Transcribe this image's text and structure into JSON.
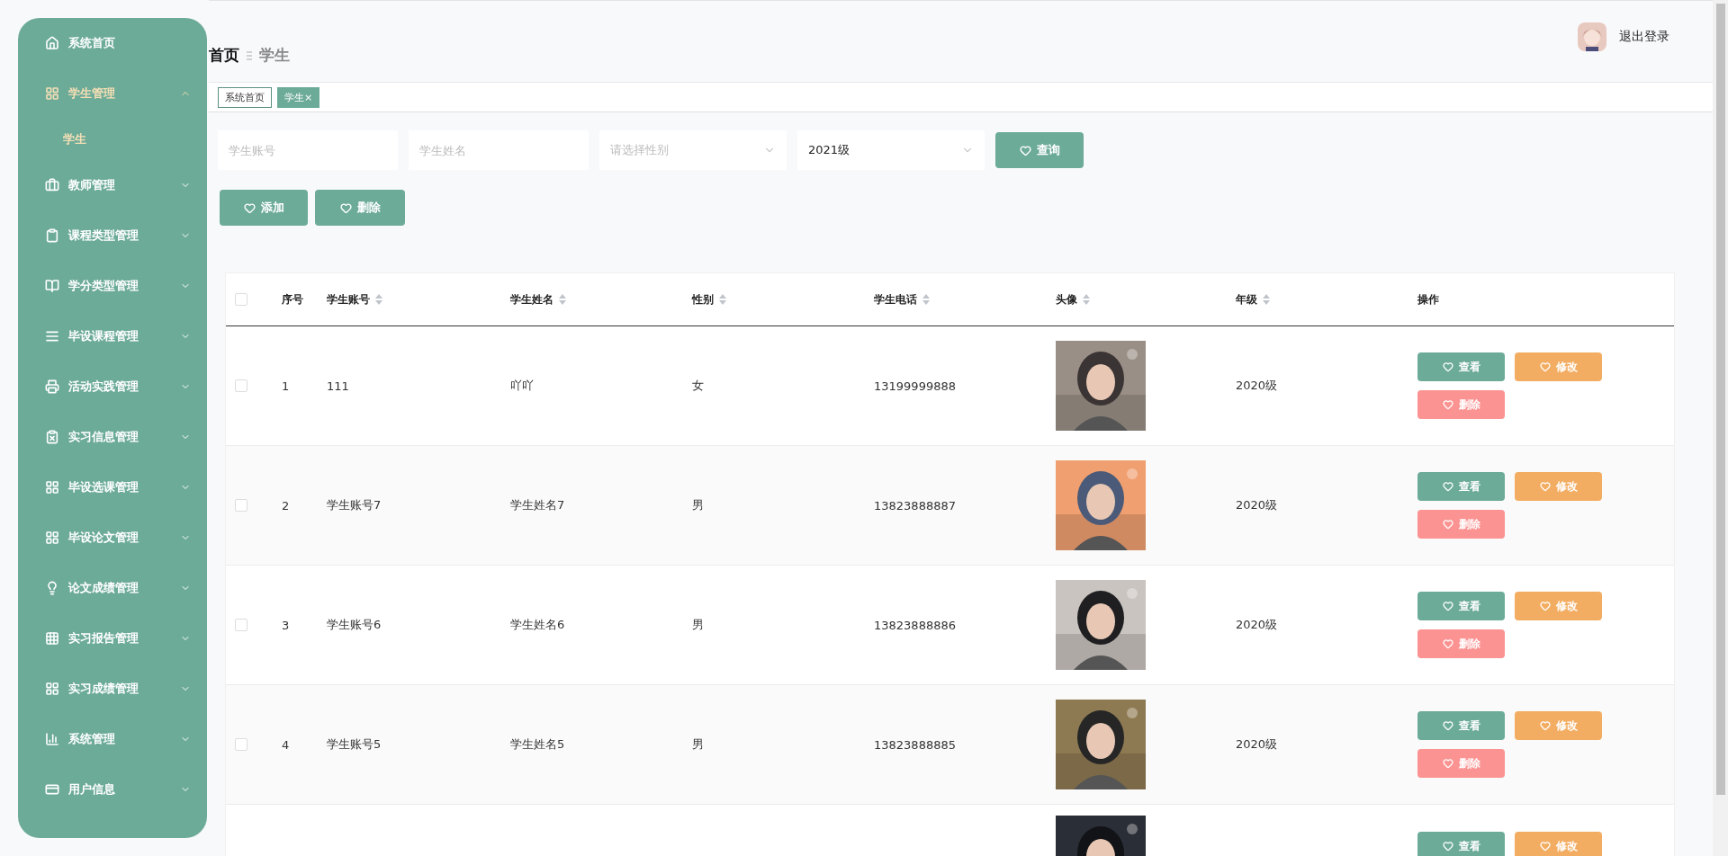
{
  "sidebar": {
    "items": [
      {
        "label": "系统首页",
        "expanded": false
      },
      {
        "label": "学生管理",
        "expanded": true,
        "children": [
          {
            "label": "学生",
            "selected": true
          }
        ]
      },
      {
        "label": "教师管理",
        "expanded": false
      },
      {
        "label": "课程类型管理",
        "expanded": false
      },
      {
        "label": "学分类型管理",
        "expanded": false
      },
      {
        "label": "毕设课程管理",
        "expanded": false
      },
      {
        "label": "活动实践管理",
        "expanded": false
      },
      {
        "label": "实习信息管理",
        "expanded": false
      },
      {
        "label": "毕设选课管理",
        "expanded": false
      },
      {
        "label": "毕设论文管理",
        "expanded": false
      },
      {
        "label": "论文成绩管理",
        "expanded": false
      },
      {
        "label": "实习报告管理",
        "expanded": false
      },
      {
        "label": "实习成绩管理",
        "expanded": false
      },
      {
        "label": "系统管理",
        "expanded": false
      },
      {
        "label": "用户信息",
        "expanded": false
      }
    ]
  },
  "header": {
    "breadcrumb": [
      "首页",
      "学生"
    ],
    "logout": "退出登录"
  },
  "tabs": [
    {
      "label": "系统首页",
      "selected": false
    },
    {
      "label": "学生",
      "close": "×",
      "selected": true
    }
  ],
  "filters": [
    {
      "kind": "input",
      "placeholder": "学生账号"
    },
    {
      "kind": "input",
      "placeholder": "学生姓名"
    },
    {
      "kind": "select",
      "placeholder": "请选择性别"
    },
    {
      "kind": "select",
      "value": "2021级"
    }
  ],
  "search_button": "查询",
  "actions": [
    "添加",
    "删除"
  ],
  "table": {
    "select_all": {
      "checked": false
    },
    "columns": [
      "序号",
      "学生账号",
      "学生姓名",
      "性别",
      "学生电话",
      "头像",
      "年级",
      "操作"
    ],
    "rows": [
      {
        "no": "1",
        "account": "111",
        "name": "吖吖",
        "gender": "女",
        "phone": "13199999888",
        "grade": "2020级",
        "actions": [
          "查看",
          "修改",
          "删除"
        ],
        "checked": false
      },
      {
        "no": "2",
        "account": "学生账号7",
        "name": "学生姓名7",
        "gender": "男",
        "phone": "13823888887",
        "grade": "2020级",
        "actions": [
          "查看",
          "修改",
          "删除"
        ],
        "checked": false
      },
      {
        "no": "3",
        "account": "学生账号6",
        "name": "学生姓名6",
        "gender": "男",
        "phone": "13823888886",
        "grade": "2020级",
        "actions": [
          "查看",
          "修改",
          "删除"
        ],
        "checked": false
      },
      {
        "no": "4",
        "account": "学生账号5",
        "name": "学生姓名5",
        "gender": "男",
        "phone": "13823888885",
        "grade": "2020级",
        "actions": [
          "查看",
          "修改",
          "删除"
        ],
        "checked": false
      },
      {
        "actions": [
          "查看",
          "修改"
        ]
      }
    ]
  }
}
